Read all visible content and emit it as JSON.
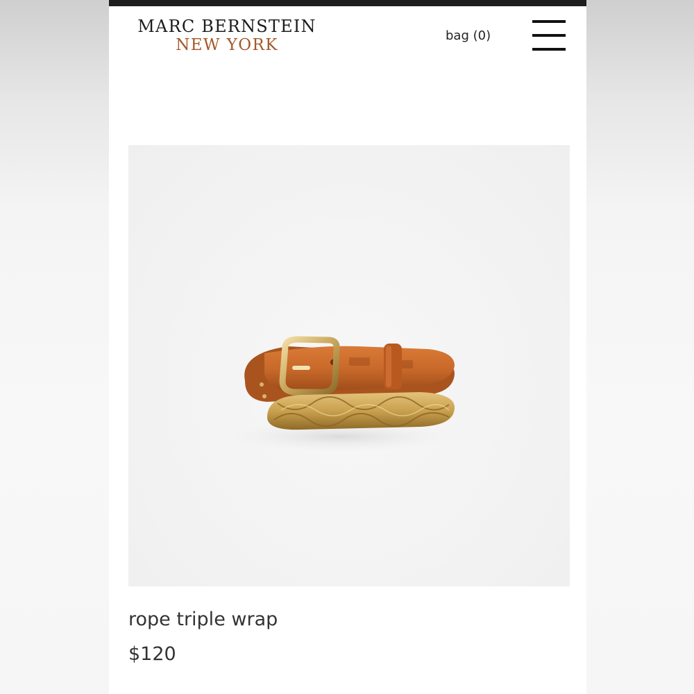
{
  "header": {
    "brand_line1": "MARC BERNSTEIN",
    "brand_line2": "NEW YORK",
    "bag_label": "bag (0)",
    "menu_icon": "hamburger-menu-icon"
  },
  "product": {
    "name": "rope triple wrap",
    "price": "$120"
  },
  "colors": {
    "brand_accent": "#a4582a",
    "leather": "#c8692a",
    "gold": "#c9a14f"
  }
}
